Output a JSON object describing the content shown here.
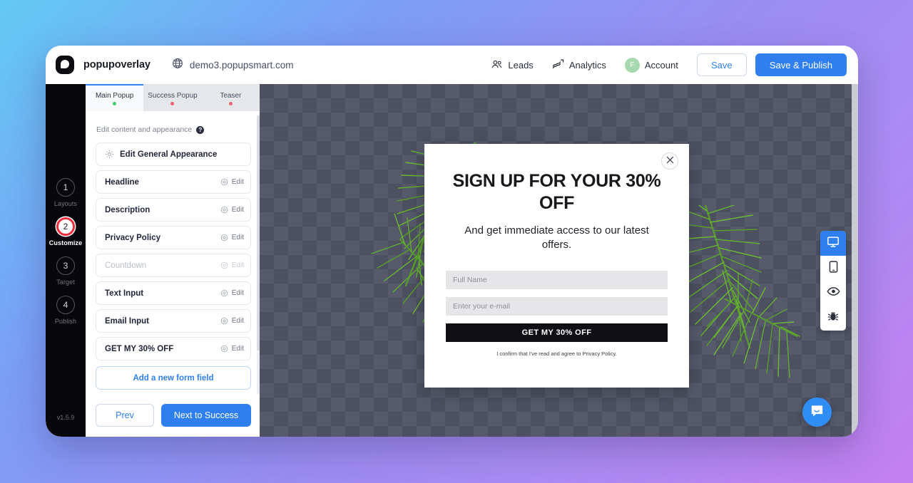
{
  "header": {
    "brand": "popupoverlay",
    "globe_icon": "globe-icon",
    "site_url": "demo3.popupsmart.com",
    "nav": [
      {
        "label": "Leads",
        "icon": "leads-icon"
      },
      {
        "label": "Analytics",
        "icon": "analytics-icon"
      }
    ],
    "account": {
      "label": "Account",
      "avatar_initial": "F",
      "avatar_color": "#a7d9ae"
    },
    "save_label": "Save",
    "publish_label": "Save & Publish",
    "accent_color": "#2f7ff0"
  },
  "steps": {
    "items": [
      {
        "number": "1",
        "label": "Layouts",
        "active": false
      },
      {
        "number": "2",
        "label": "Customize",
        "active": true
      },
      {
        "number": "3",
        "label": "Target",
        "active": false
      },
      {
        "number": "4",
        "label": "Publish",
        "active": false
      }
    ],
    "active_ring_color": "#ee2b3c",
    "version": "v1.5.9"
  },
  "panel": {
    "tabs": [
      {
        "label": "Main Popup",
        "dot_color": "#3ecf6b",
        "active": true
      },
      {
        "label": "Success Popup",
        "dot_color": "#f0626f",
        "active": false
      },
      {
        "label": "Teaser",
        "dot_color": "#f0626f",
        "active": false
      }
    ],
    "hint": "Edit content and appearance",
    "help_glyph": "?",
    "general_row": {
      "label": "Edit General Appearance",
      "icon": "gear-icon"
    },
    "fields": [
      {
        "label": "Headline",
        "edit_label": "Edit",
        "disabled": false
      },
      {
        "label": "Description",
        "edit_label": "Edit",
        "disabled": false
      },
      {
        "label": "Privacy Policy",
        "edit_label": "Edit",
        "disabled": false
      },
      {
        "label": "Countdown",
        "edit_label": "Edit",
        "disabled": true
      },
      {
        "label": "Text Input",
        "edit_label": "Edit",
        "disabled": false
      },
      {
        "label": "Email Input",
        "edit_label": "Edit",
        "disabled": false
      },
      {
        "label": "GET MY 30% OFF",
        "edit_label": "Edit",
        "disabled": false
      }
    ],
    "add_field_label": "Add a new form field",
    "prev_label": "Prev",
    "next_label": "Next to Success"
  },
  "popup": {
    "close_icon": "close-icon",
    "headline": "SIGN UP FOR YOUR 30% OFF",
    "description": "And get immediate access to our latest offers.",
    "name_placeholder": "Full Name",
    "email_placeholder": "Enter your e-mail",
    "cta_label": "GET MY 30% OFF",
    "consent_text": "I confirm that I've read and agree to Privacy Policy.",
    "cta_bg": "#101014"
  },
  "device_toolbar": {
    "buttons": [
      {
        "name": "desktop-view",
        "icon": "desktop-icon",
        "active": true,
        "dot_color": "#3ecf6b"
      },
      {
        "name": "mobile-view",
        "icon": "mobile-icon",
        "active": false,
        "dot_color": "#f0454f"
      },
      {
        "name": "preview",
        "icon": "eye-icon",
        "active": false,
        "dot_color": ""
      },
      {
        "name": "debug",
        "icon": "bug-icon",
        "active": false,
        "dot_color": ""
      }
    ]
  },
  "chat": {
    "icon": "chat-bubble-icon",
    "color": "#2f8ef5"
  }
}
